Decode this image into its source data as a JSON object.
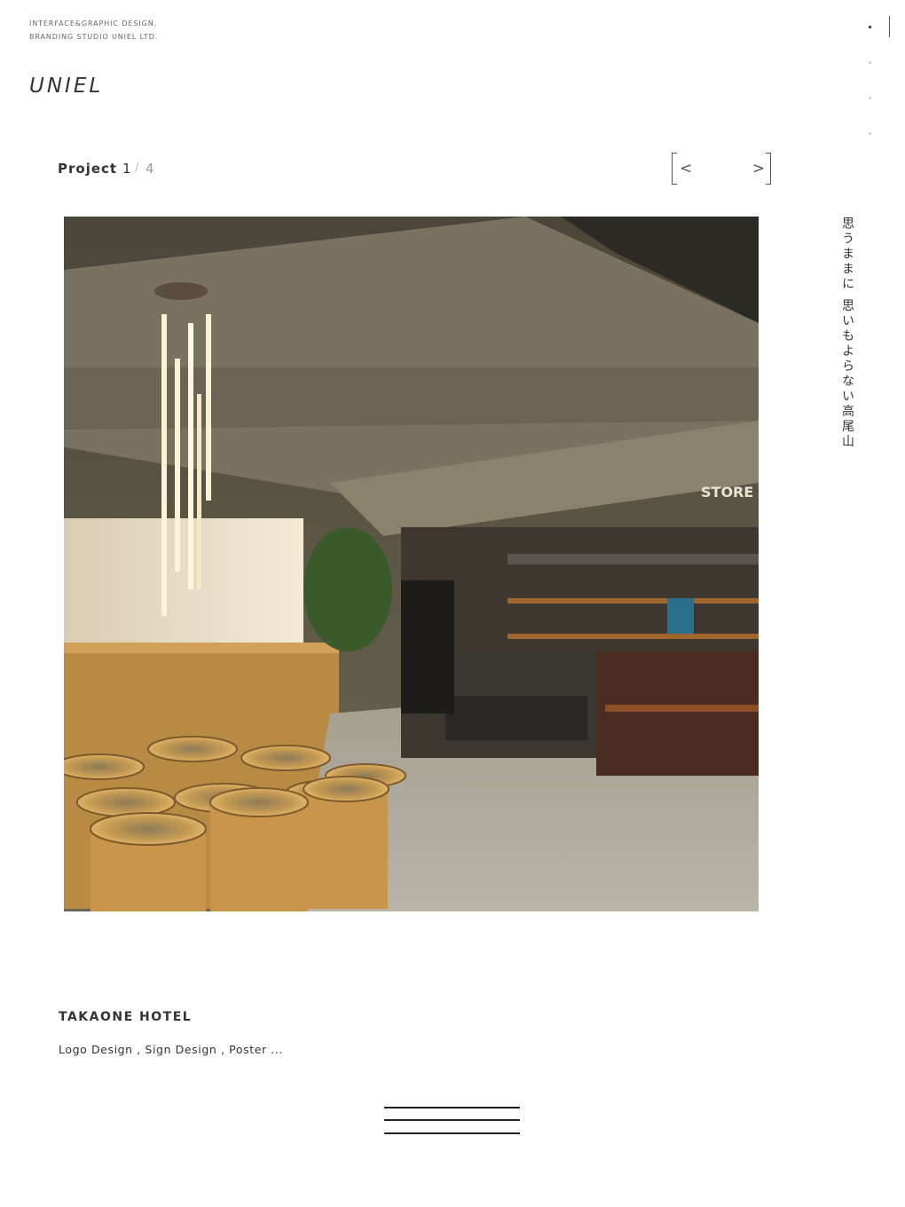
{
  "header": {
    "tagline_line1": "INTERFACE&GRAPHIC DESIGN.",
    "tagline_line2": "BRANDING STUDIO UNIEL LTD.",
    "logo": "UNIEL"
  },
  "pager": {
    "label": "Project",
    "current": "1",
    "separator": "/",
    "total": "4",
    "prev_label": "<",
    "next_label": ">"
  },
  "side_dots": {
    "count": 4,
    "active_index": 0
  },
  "project": {
    "image_icon": "hotel-lobby-photo",
    "vertical_caption": "思うままに 思いもよらない高尾山",
    "title": "TAKAONE HOTEL",
    "tags": "Logo Design ,  Sign Design ,  Poster ..."
  },
  "menu": {
    "icon": "hamburger-menu-icon"
  },
  "colors": {
    "text": "#333333",
    "muted": "#999999",
    "background": "#ffffff"
  }
}
